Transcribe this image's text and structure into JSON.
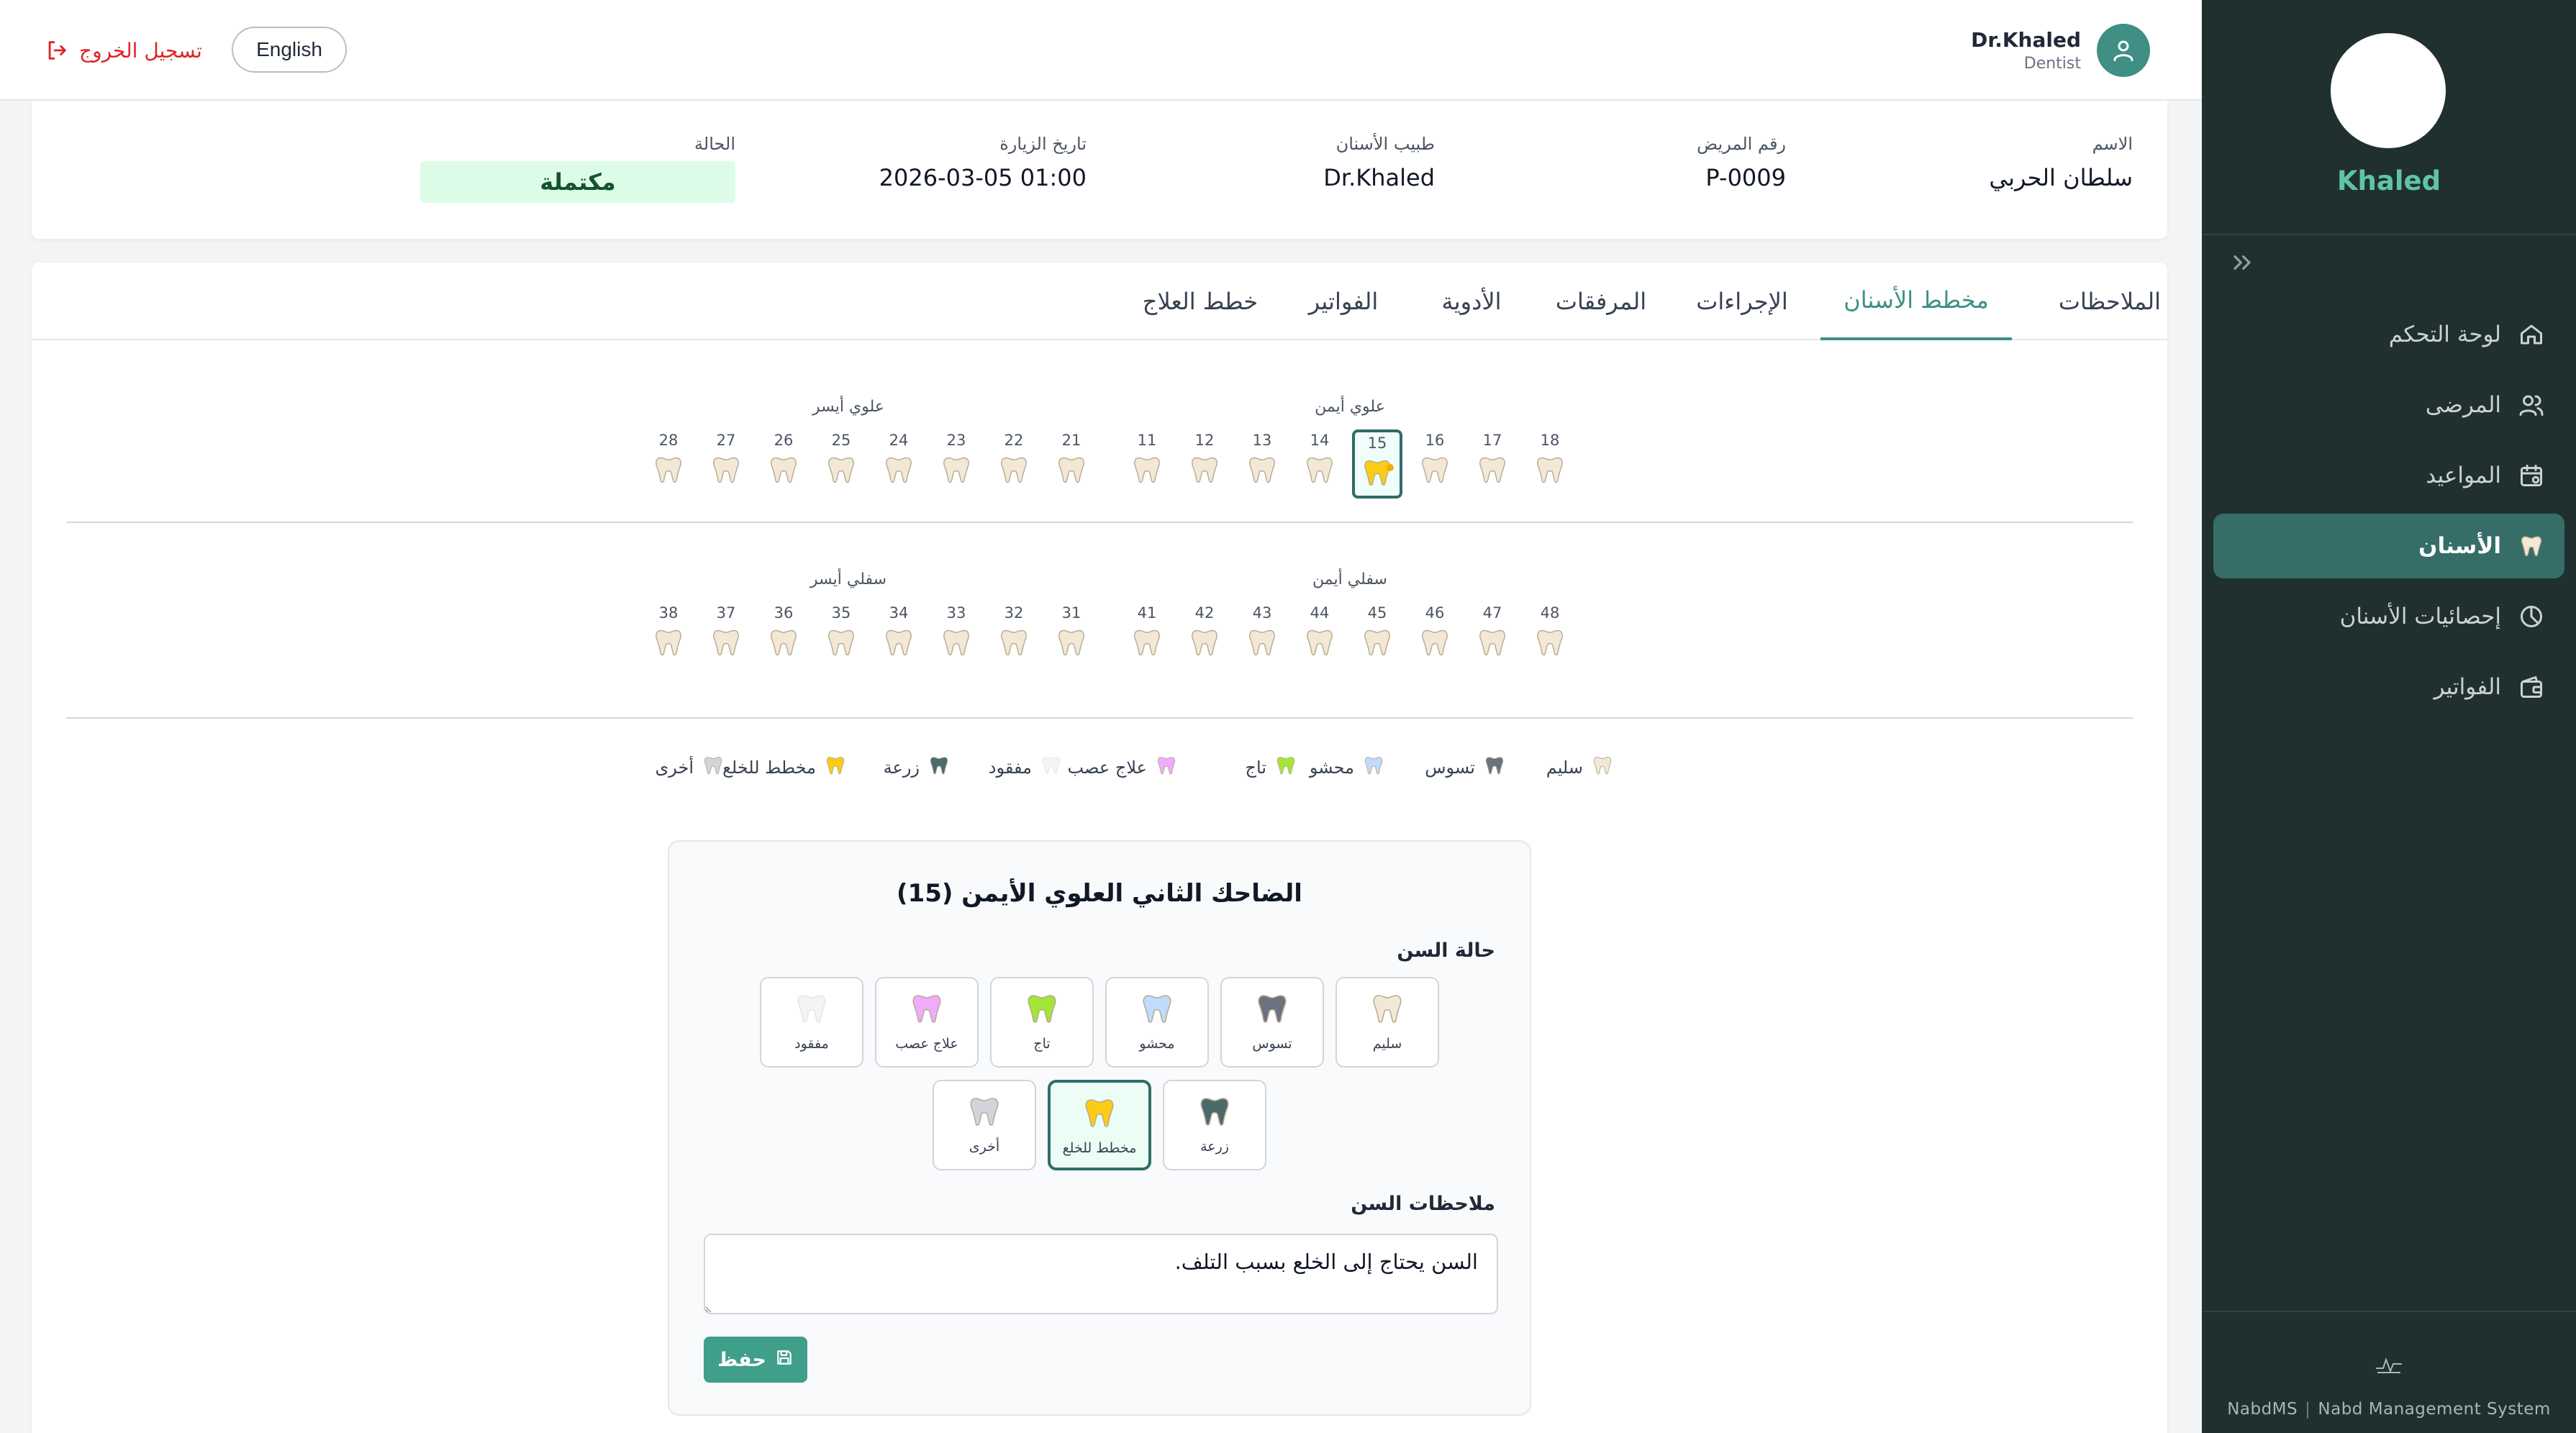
{
  "colors": {
    "sidebar_bg": "#20302f",
    "accent": "#3f8f84",
    "accent_light": "#5fc4a7",
    "active_nav_bg": "#376d69",
    "status_bg": "#dcfce7",
    "logout_red": "#dc2626"
  },
  "sidebar": {
    "profile_name": "Khaled",
    "collapse_icon": "chevrons-right-icon",
    "items": [
      {
        "label": "لوحة التحكم",
        "icon": "home-icon",
        "active": false
      },
      {
        "label": "المرضى",
        "icon": "users-icon",
        "active": false
      },
      {
        "label": "المواعيد",
        "icon": "calendar-icon",
        "active": false
      },
      {
        "label": "الأسنان",
        "icon": "tooth-icon",
        "active": true
      },
      {
        "label": "إحصائيات الأسنان",
        "icon": "pie-chart-icon",
        "active": false
      },
      {
        "label": "الفواتير",
        "icon": "wallet-icon",
        "active": false
      }
    ],
    "footer": {
      "short": "NabdMS",
      "long": "Nabd Management System"
    }
  },
  "topbar": {
    "user_name": "Dr.Khaled",
    "user_role": "Dentist",
    "language_button": "English",
    "logout_label": "تسجيل الخروج"
  },
  "visit": {
    "name_label": "الاسم",
    "name": "سلطان الحربي",
    "patient_no_label": "رقم المريض",
    "patient_no": "P-0009",
    "dentist_label": "طبيب الأسنان",
    "dentist": "Dr.Khaled",
    "date_label": "تاريخ الزيارة",
    "date": "2026-03-05 01:00",
    "status_label": "الحالة",
    "status": "مكتملة"
  },
  "tabs": [
    "الملاحظات",
    "مخطط الأسنان",
    "الإجراءات",
    "المرفقات",
    "الأدوية",
    "الفواتير",
    "خطط العلاج"
  ],
  "active_tab": "مخطط الأسنان",
  "chart": {
    "upper_right_label": "علوي أيمن",
    "upper_left_label": "علوي أيسر",
    "lower_right_label": "سفلي أيمن",
    "lower_left_label": "سفلي أيسر",
    "upper_right": [
      "18",
      "17",
      "16",
      "15",
      "14",
      "13",
      "12",
      "11"
    ],
    "upper_left": [
      "21",
      "22",
      "23",
      "24",
      "25",
      "26",
      "27",
      "28"
    ],
    "lower_right": [
      "48",
      "47",
      "46",
      "45",
      "44",
      "43",
      "42",
      "41"
    ],
    "lower_left": [
      "31",
      "32",
      "33",
      "34",
      "35",
      "36",
      "37",
      "38"
    ],
    "selected_tooth": "15",
    "selected_status": "مخطط للخلع"
  },
  "legend": [
    {
      "label": "سليم",
      "color": "#f2e8d5"
    },
    {
      "label": "تسوس",
      "color": "#6b7280"
    },
    {
      "label": "محشو",
      "color": "#bfdbfe"
    },
    {
      "label": "تاج",
      "color": "#a3e635"
    },
    {
      "label": "علاج عصب",
      "color": "#f0abfc"
    },
    {
      "label": "مفقود",
      "color": "#f3f4f6"
    },
    {
      "label": "زرعة",
      "color": "#4b6b6b"
    },
    {
      "label": "مخطط للخلع",
      "color": "#facc15"
    },
    {
      "label": "أخرى",
      "color": "#d1d5db"
    }
  ],
  "detail": {
    "title": "الضاحك الثاني العلوي الأيمن (15)",
    "status_section": "حالة السن",
    "notes_section": "ملاحظات السن",
    "notes_value": "السن يحتاج إلى الخلع بسبب التلف.",
    "save_label": "حفظ",
    "conditions": [
      {
        "label": "سليم",
        "color": "#f2e8d5"
      },
      {
        "label": "تسوس",
        "color": "#6b7280"
      },
      {
        "label": "محشو",
        "color": "#bfdbfe"
      },
      {
        "label": "تاج",
        "color": "#a3e635"
      },
      {
        "label": "علاج عصب",
        "color": "#f0abfc"
      },
      {
        "label": "مفقود",
        "color": "#f3f4f6"
      },
      {
        "label": "زرعة",
        "color": "#4b6b6b"
      },
      {
        "label": "مخطط للخلع",
        "color": "#facc15"
      },
      {
        "label": "أخرى",
        "color": "#d1d5db"
      }
    ],
    "active_condition": "مخطط للخلع"
  }
}
